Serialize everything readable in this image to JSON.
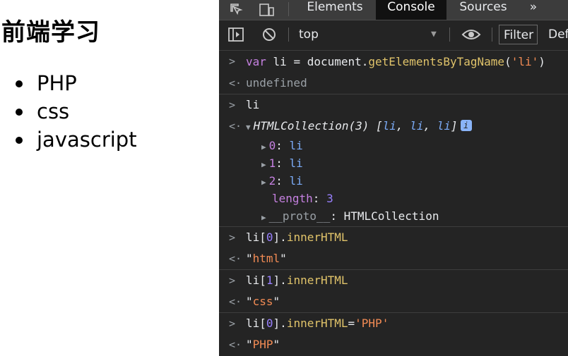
{
  "page": {
    "heading": "前端学习",
    "list_items": [
      "PHP",
      "css",
      "javascript"
    ]
  },
  "devtools": {
    "tabs": [
      "Elements",
      "Console",
      "Sources"
    ],
    "more_tabs_glyph": "»",
    "active_tab": "Console",
    "context": "top",
    "filter_placeholder": "Filter",
    "levels_label": "Def",
    "colors": {
      "background": "#242424",
      "keyword": "#c580e0",
      "function": "#e0c36a",
      "string": "#f28b54",
      "number": "#9980ff",
      "property": "#7cacf8"
    },
    "console": {
      "cmd1": {
        "kw": "var",
        "rest1": " li = document.",
        "fn": "getElementsByTagName",
        "open": "(",
        "arg": "'li'",
        "close": ")"
      },
      "res1": "undefined",
      "cmd2": "li",
      "res2": {
        "name": "HTMLCollection(3)",
        "preview_open": " [",
        "items": [
          "li",
          "li",
          "li"
        ],
        "preview_close": "]",
        "info": "i"
      },
      "children": [
        {
          "key": "0",
          "val": "li"
        },
        {
          "key": "1",
          "val": "li"
        },
        {
          "key": "2",
          "val": "li"
        }
      ],
      "length_key": "length",
      "length_val": "3",
      "proto_key": "__proto__",
      "proto_val": "HTMLCollection",
      "cmd3": {
        "a": "li[",
        "n": "0",
        "b": "].",
        "fn": "innerHTML"
      },
      "res3": {
        "q1": "\"",
        "s": "html",
        "q2": "\""
      },
      "cmd4": {
        "a": "li[",
        "n": "1",
        "b": "].",
        "fn": "innerHTML"
      },
      "res4": {
        "q1": "\"",
        "s": "css",
        "q2": "\""
      },
      "cmd5": {
        "a": "li[",
        "n": "0",
        "b": "].",
        "fn": "innerHTML",
        "eq": "=",
        "str": "'PHP'"
      },
      "res5": {
        "q1": "\"",
        "s": "PHP",
        "q2": "\""
      }
    }
  }
}
